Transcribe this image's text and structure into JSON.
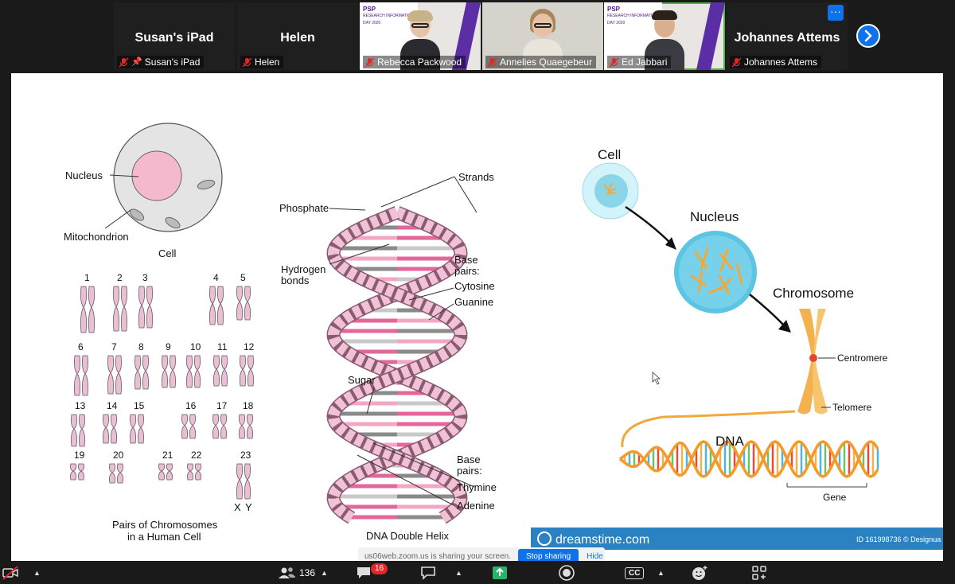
{
  "participants": [
    {
      "name": "Susan's iPad",
      "label": "Susan's iPad",
      "video": false,
      "pinned": true
    },
    {
      "name": "Helen",
      "label": "Helen",
      "video": false
    },
    {
      "name": "Rebecca Packwood",
      "label": "Rebecca Packwood",
      "video": true
    },
    {
      "name": "Annelies Quaegebeur",
      "label": "Annelies Quaegebeur",
      "video": true
    },
    {
      "name": "Ed Jabbari",
      "label": "Ed Jabbari",
      "video": true
    },
    {
      "name": "Johannes Attems",
      "label": "Johannes Attems",
      "video": false
    }
  ],
  "slide_brand": {
    "logo": "PSP",
    "subtitle": "RESEARCH INFORMATION DAY 2020"
  },
  "more_label": "···",
  "diagram": {
    "cell": {
      "nucleus": "Nucleus",
      "mitochondrion": "Mitochondrion",
      "caption": "Cell"
    },
    "chromosome_numbers": [
      "1",
      "2",
      "3",
      "4",
      "5",
      "6",
      "7",
      "8",
      "9",
      "10",
      "11",
      "12",
      "13",
      "14",
      "15",
      "16",
      "17",
      "18",
      "19",
      "20",
      "21",
      "22",
      "23"
    ],
    "chromosome_xy": [
      "X",
      "Y"
    ],
    "chromosome_caption_1": "Pairs of Chromosomes",
    "chromosome_caption_2": "in a Human Cell",
    "helix": {
      "strands": "Strands",
      "phosphate": "Phosphate",
      "hydrogen_1": "Hydrogen",
      "hydrogen_2": "bonds",
      "base_pairs_1": "Base",
      "base_pairs_2": "pairs:",
      "cytosine": "Cytosine",
      "guanine": "Guanine",
      "sugar": "Sugar",
      "base_pairs_b1": "Base",
      "base_pairs_b2": "pairs:",
      "thymine": "Thymine",
      "adenine": "Adenine",
      "caption": "DNA Double Helix"
    },
    "right": {
      "cell": "Cell",
      "nucleus": "Nucleus",
      "chromosome": "Chromosome",
      "centromere": "Centromere",
      "telomere": "Telomere",
      "dna": "DNA",
      "gene": "Gene",
      "watermark": "dreamstime.com",
      "id_text": "ID 161998736 © Designua"
    }
  },
  "share_banner": {
    "text": "us06web.zoom.us is sharing your screen.",
    "stop": "Stop sharing",
    "hide": "Hide"
  },
  "toolbar": {
    "participants_count": "136",
    "chat_badge": "16",
    "cc": "CC"
  },
  "colors": {
    "zoom_blue": "#0e72ed",
    "pink": "#e8a6c4",
    "alert": "#e02828"
  }
}
